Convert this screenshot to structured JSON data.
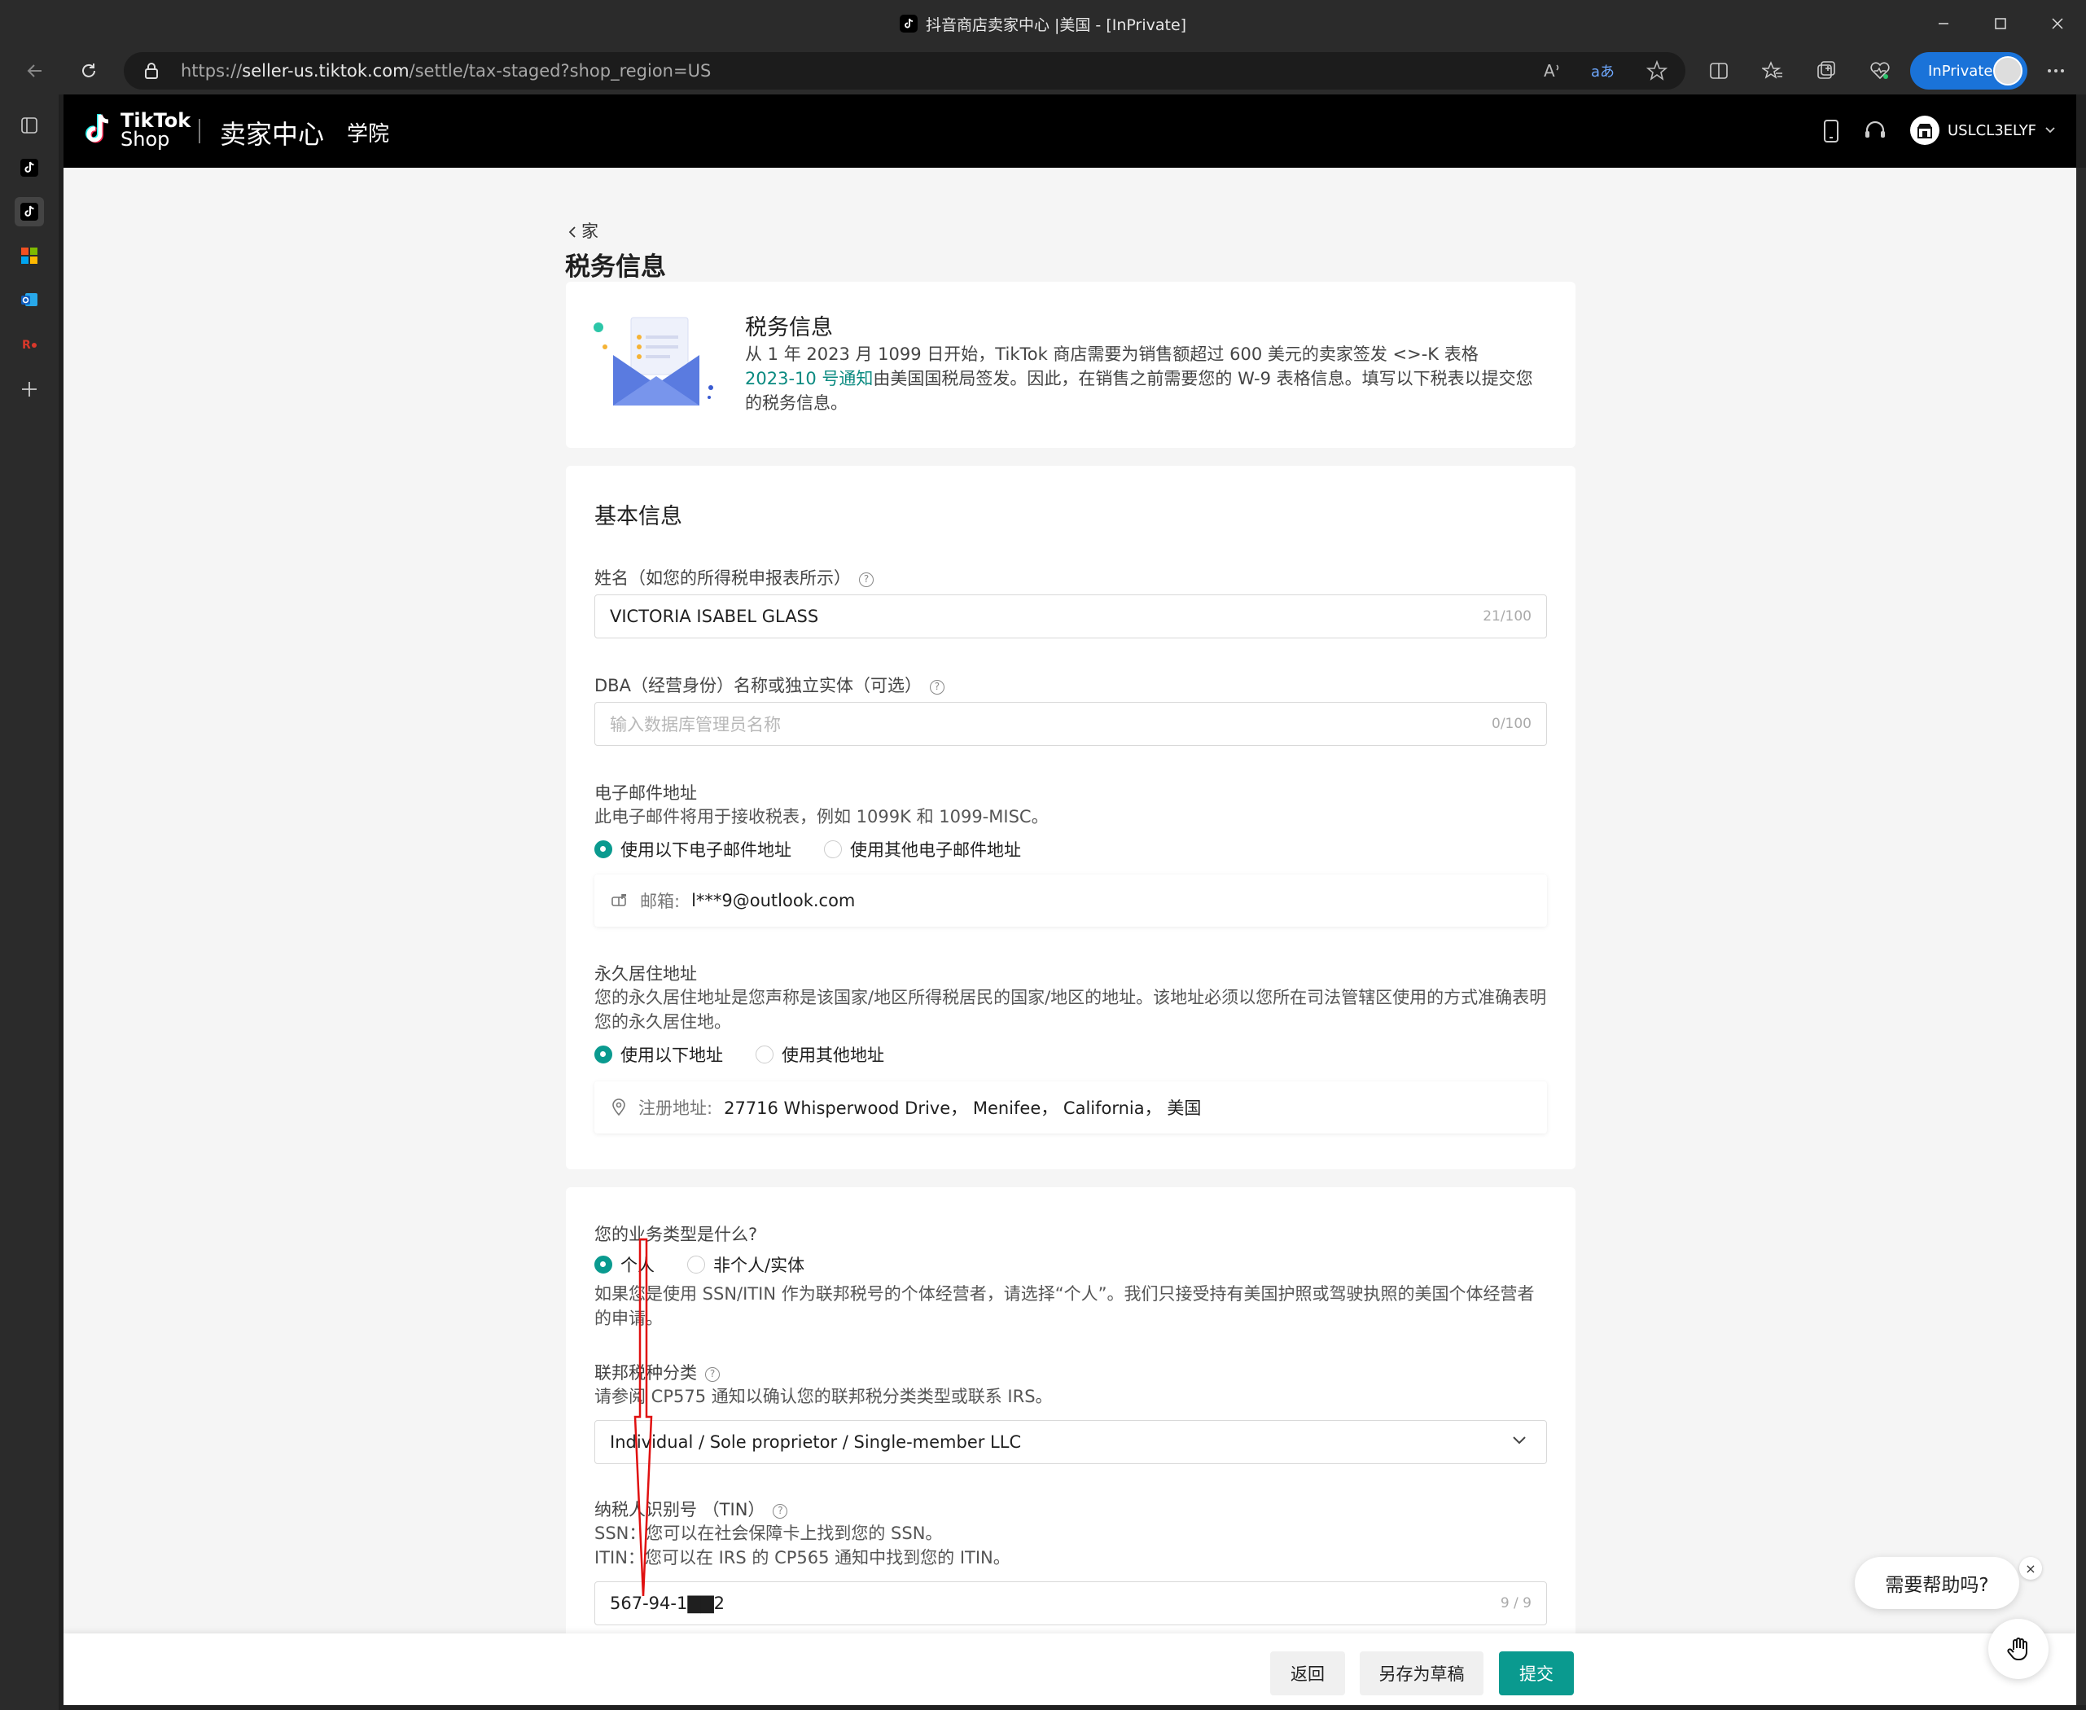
{
  "browser": {
    "window_title": "抖音商店卖家中心 |美国 - [InPrivate]",
    "url_prefix": "https://",
    "url_host": "seller-us.tiktok.com",
    "url_path": "/settle/tax-staged?shop_region=US",
    "inprivate_label": "InPrivate"
  },
  "header": {
    "logo_line1": "TikTok",
    "logo_line2": "Shop",
    "seller_center": "卖家中心",
    "academy": "学院",
    "account_id": "USLCL3ELYF"
  },
  "page": {
    "breadcrumb": "家",
    "title": "税务信息"
  },
  "info_card": {
    "title": "税务信息",
    "text_part1": "从 1 年 2023 月 1099 日开始，TikTok 商店需要为销售额超过 600 美元的卖家签发 <>-K 表格",
    "link": "2023-10 号通知",
    "text_part2": "由美国国税局签发。因此，在销售之前需要您的 W-9 表格信息。填写以下税表以提交您的税务信息。"
  },
  "basic": {
    "section_title": "基本信息",
    "name_label": "姓名（如您的所得税申报表所示）",
    "name_value": "VICTORIA ISABEL GLASS",
    "name_count": "21/100",
    "dba_label": "DBA（经营身份）名称或独立实体（可选）",
    "dba_placeholder": "输入数据库管理员名称",
    "dba_count": "0/100",
    "email_label": "电子邮件地址",
    "email_desc": "此电子邮件将用于接收税表，例如 1099K 和 1099-MISC。",
    "email_opt1": "使用以下电子邮件地址",
    "email_opt2": "使用其他电子邮件地址",
    "email_key": "邮箱:",
    "email_value": "l***9@outlook.com",
    "address_label": "永久居住地址",
    "address_desc": "您的永久居住地址是您声称是该国家/地区所得税居民的国家/地区的地址。该地址必须以您所在司法管辖区使用的方式准确表明您的永久居住地。",
    "addr_opt1": "使用以下地址",
    "addr_opt2": "使用其他地址",
    "addr_key": "注册地址:",
    "addr_value": "27716 Whisperwood Drive， Menifee， California， 美国"
  },
  "business": {
    "question": "您的业务类型是什么?",
    "opt1": "个人",
    "opt2": "非个人/实体",
    "desc": "如果您是使用 SSN/ITIN 作为联邦税号的个体经营者，请选择“个人”。我们只接受持有美国护照或驾驶执照的美国个体经营者的申请。",
    "fed_label": "联邦税种分类",
    "fed_desc": "请参阅 CP575 通知以确认您的联邦税分类类型或联系 IRS。",
    "fed_value": "Individual / Sole proprietor / Single-member LLC",
    "tin_label": "纳税人识别号 （TIN）",
    "tin_desc1": "SSN：您可以在社会保障卡上找到您的 SSN。",
    "tin_desc2": "ITIN：您可以在 IRS 的 CP565 通知中找到您的 ITIN。",
    "tin_value": "567-94-1▇▇2",
    "tin_count": "9 / 9"
  },
  "footer": {
    "back": "返回",
    "save_draft": "另存为草稿",
    "submit": "提交"
  },
  "help": {
    "bubble": "需要帮助吗?",
    "close": "×"
  },
  "colors": {
    "accent": "#0a9a8f",
    "inprivate": "#1a73d9",
    "annotation": "#e01010"
  }
}
